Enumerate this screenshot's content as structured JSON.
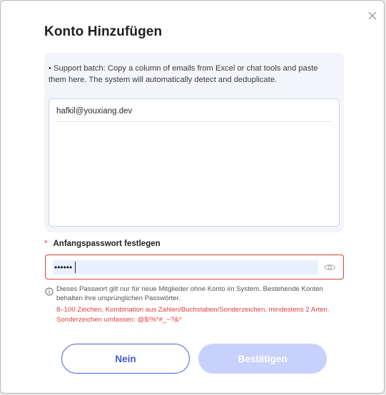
{
  "dialog": {
    "title": "Konto Hinzufügen",
    "close_icon": "close-icon"
  },
  "batch": {
    "hint": "• Support batch: Copy a column of emails from Excel or chat tools and paste them here. The system will automatically detect and deduplicate.",
    "emails": [
      "hafkil@youxiang.dev"
    ]
  },
  "password": {
    "required_mark": "*",
    "label": "Anfangspasswort festlegen",
    "value": "••••••",
    "toggle_icon": "eye-icon",
    "info_icon": "info-icon",
    "info": "Dieses Passwort gilt nur für neue Mitglieder ohne Konto im System. Bestehende Konten behalten ihre ursprünglichen Passwörter.",
    "rules_line1": "8–100 Zeichen, Kombination aus Zahlen/Buchstaben/Sonderzeichen, mindestens 2 Arten.",
    "rules_line2": "Sonderzeichen umfassen: @$!%*#_~?&^"
  },
  "actions": {
    "cancel_label": "Nein",
    "confirm_label": "Bestätigen"
  },
  "colors": {
    "primary": "#4960e0",
    "primary_disabled": "#c8d1fb",
    "error": "#d64141",
    "panel_bg": "#f4f5fb"
  }
}
